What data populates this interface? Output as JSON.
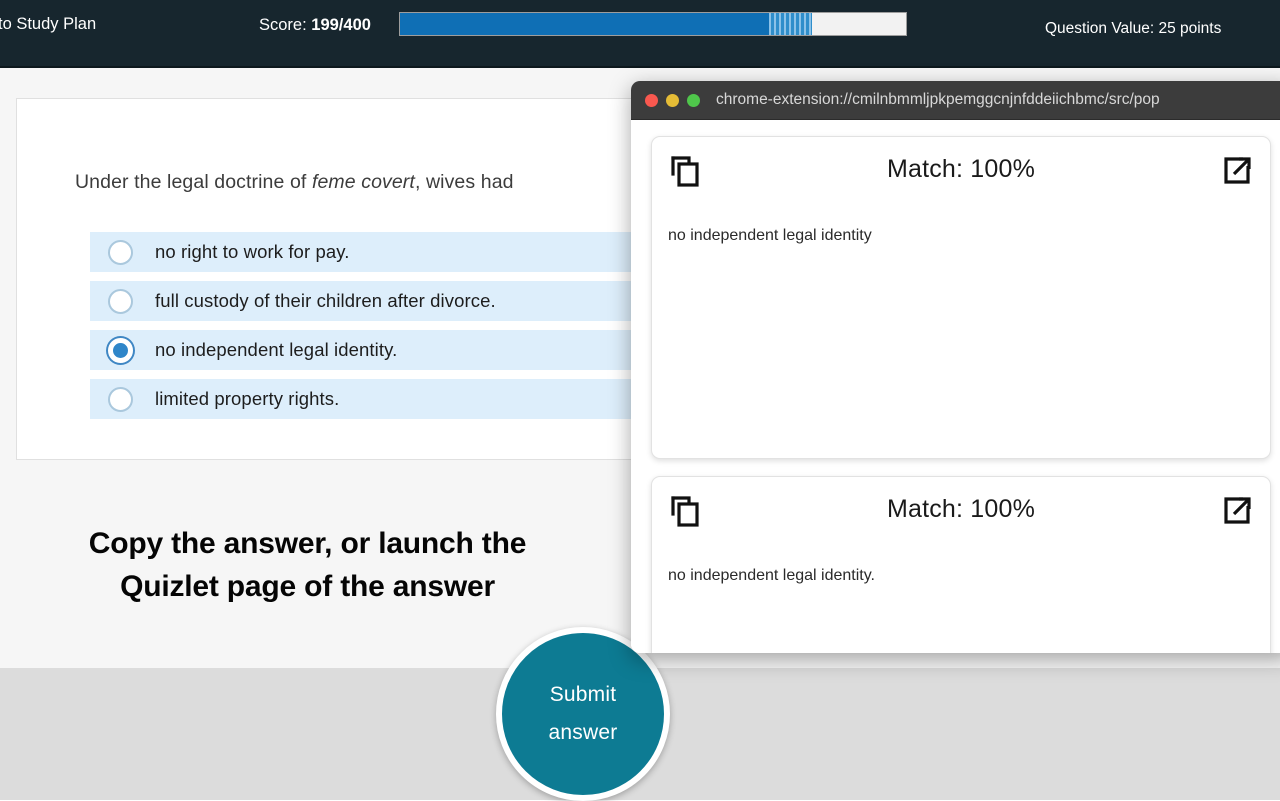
{
  "header": {
    "study_plan_link": "to Study Plan",
    "score_prefix": "Score: ",
    "score_value": "199/400",
    "question_value": "Question Value: 25 points",
    "progress_percent": 73,
    "accent_blue": "#0f6fb5",
    "background": "#17262e"
  },
  "question": {
    "stem_before": "Under the legal doctrine of ",
    "stem_italic": "feme covert",
    "stem_after": ", wives had",
    "options": [
      {
        "label": "no right to work for pay.",
        "selected": false
      },
      {
        "label": "full custody of their children after divorce.",
        "selected": false
      },
      {
        "label": "no independent legal identity.",
        "selected": true
      },
      {
        "label": "limited property rights.",
        "selected": false
      }
    ]
  },
  "instruction": {
    "line1": "Copy the answer, or launch the",
    "line2": "Quizlet page of the answer"
  },
  "submit": {
    "line1": "Submit",
    "line2": "answer",
    "color": "#0d7b93"
  },
  "extension_window": {
    "url": "chrome-extension://cmilnbmmljpkpemggcnjnfddeiichbmc/src/pop",
    "traffic_lights": {
      "close": "close-button",
      "minimize": "minimize-button",
      "maximize": "maximize-button"
    },
    "cards": [
      {
        "title": "Match: 100%",
        "text": "no independent legal identity",
        "copy_icon": "copy-icon",
        "launch_icon": "external-link-icon"
      },
      {
        "title": "Match: 100%",
        "text": "no independent legal identity.",
        "copy_icon": "copy-icon",
        "launch_icon": "external-link-icon"
      }
    ]
  }
}
